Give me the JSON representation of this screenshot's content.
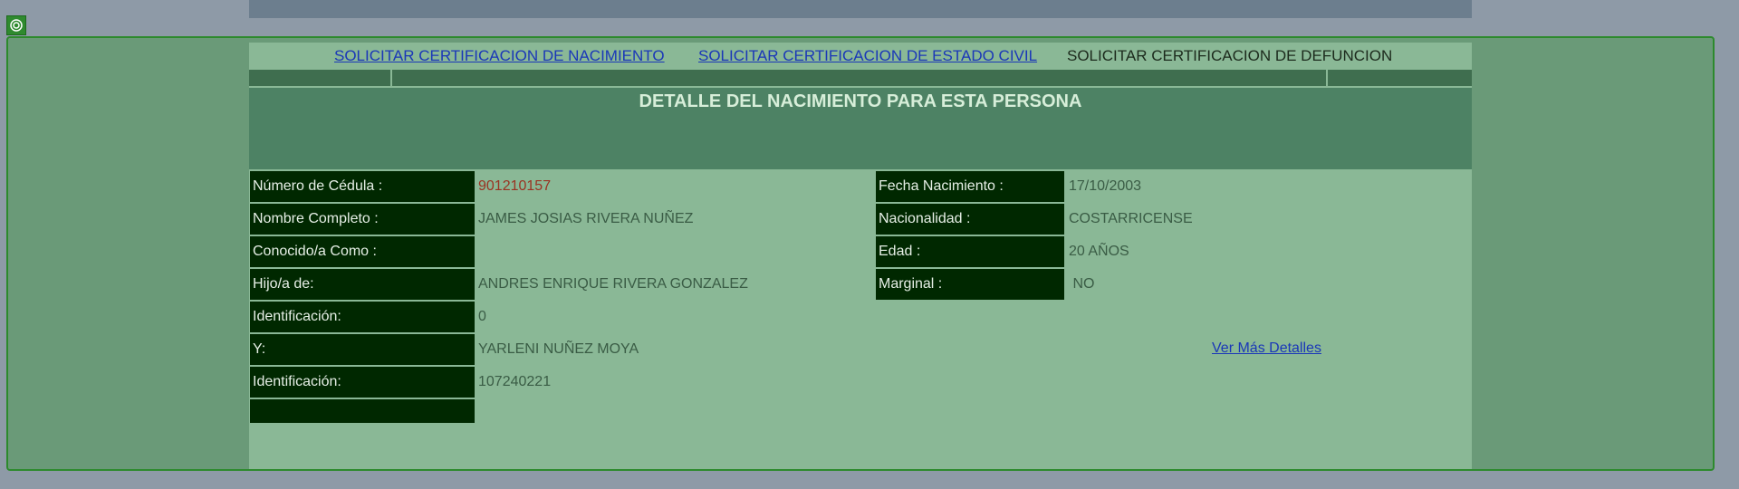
{
  "nav": {
    "link_nacimiento": "SOLICITAR CERTIFICACION DE NACIMIENTO",
    "link_estado_civil": "SOLICITAR CERTIFICACION DE ESTADO CIVIL",
    "text_defuncion": "SOLICITAR CERTIFICACION DE DEFUNCION"
  },
  "header": {
    "title": "DETALLE DEL NACIMIENTO PARA ESTA PERSONA"
  },
  "left_fields": [
    {
      "label": "Número de Cédula :",
      "value": "901210157"
    },
    {
      "label": "Nombre Completo :",
      "value": "JAMES JOSIAS RIVERA NUÑEZ"
    },
    {
      "label": "Conocido/a Como :",
      "value": ""
    },
    {
      "label": "Hijo/a de:",
      "value": "ANDRES ENRIQUE RIVERA GONZALEZ"
    },
    {
      "label": "Identificación:",
      "value": "0"
    },
    {
      "label": "Y:",
      "value": "YARLENI NUÑEZ MOYA"
    },
    {
      "label": "Identificación:",
      "value": "107240221"
    },
    {
      "label": "",
      "value": ""
    }
  ],
  "right_fields": [
    {
      "label": "Fecha Nacimiento :",
      "value": "17/10/2003"
    },
    {
      "label": "Nacionalidad :",
      "value": "COSTARRICENSE"
    },
    {
      "label": "Edad :",
      "value": "20 AÑOS"
    },
    {
      "label": "Marginal :",
      "value": " NO"
    }
  ],
  "more_details_label": "Ver Más Detalles",
  "colors": {
    "label_bg": "#002800",
    "content_bg": "#8ab896",
    "header_bg": "#4d8264",
    "link": "#1a37b8",
    "cedula_value": "#9a3322"
  },
  "icons": {
    "corner_badge": "target-icon"
  }
}
